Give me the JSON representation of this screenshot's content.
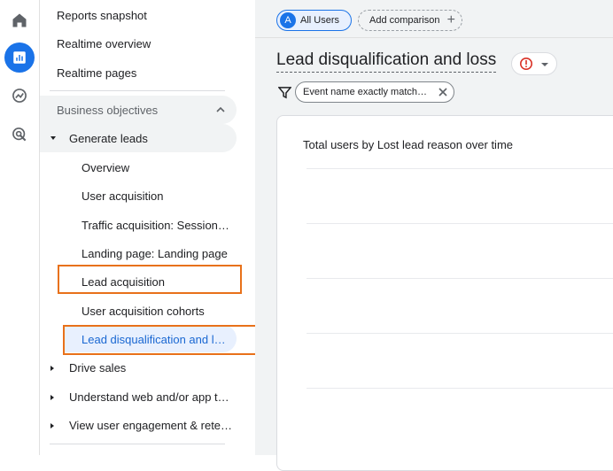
{
  "rail": {
    "icons": [
      "home-icon",
      "reports-icon",
      "explore-icon",
      "advertising-icon"
    ],
    "active_color": "#1a73e8"
  },
  "nav": {
    "top_items": [
      "Reports snapshot",
      "Realtime overview",
      "Realtime pages"
    ],
    "section": "Business objectives",
    "group": "Generate leads",
    "sub_items": [
      "Overview",
      "User acquisition",
      "Traffic acquisition: Session…",
      "Landing page: Landing page",
      "Lead acquisition",
      "User acquisition cohorts",
      "Lead disqualification and l…"
    ],
    "collapsed_groups": [
      "Drive sales",
      "Understand web and/or app t…",
      "View user engagement & rete…"
    ],
    "active_color": "#1967d2",
    "highlight_color": "#e8711a"
  },
  "topbar": {
    "user_chip_letter": "A",
    "user_chip_label": "All Users",
    "compare_label": "Add comparison"
  },
  "report": {
    "title": "Lead disqualification and loss",
    "filter_label": "Event name exactly match…",
    "card_title": "Total users by Lost lead reason over time"
  }
}
